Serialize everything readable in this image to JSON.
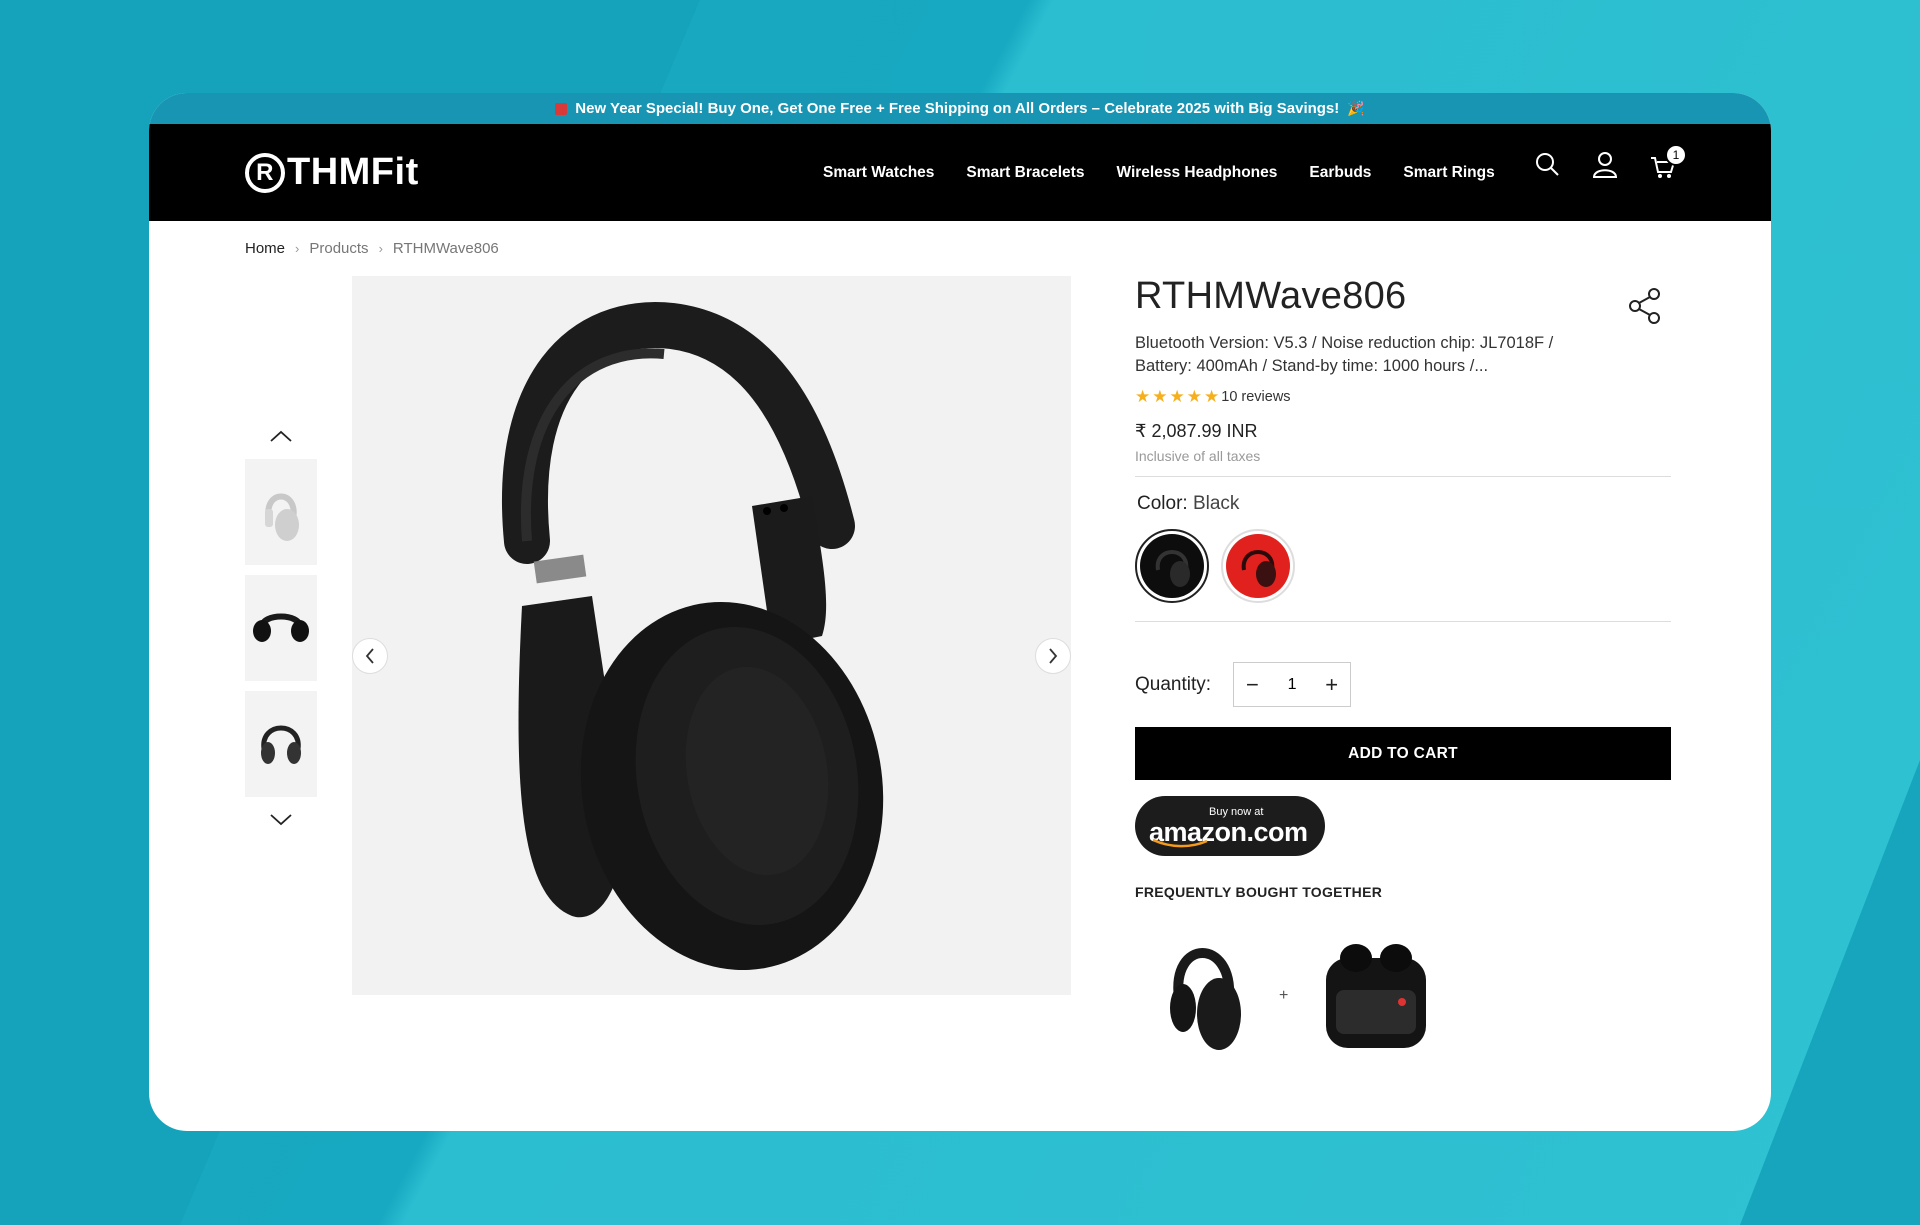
{
  "announcement": {
    "text": "New Year Special! Buy One, Get One Free + Free Shipping on All Orders – Celebrate 2025 with Big Savings!",
    "party_icon": "🎉"
  },
  "header": {
    "logo_text": "THMFit",
    "logo_mark": "R",
    "nav": [
      "Smart Watches",
      "Smart Bracelets",
      "Wireless Headphones",
      "Earbuds",
      "Smart Rings"
    ],
    "cart_count": "1"
  },
  "breadcrumb": {
    "home": "Home",
    "products": "Products",
    "current": "RTHMWave806"
  },
  "product": {
    "title": "RTHMWave806",
    "description": "Bluetooth Version: V5.3 / Noise reduction chip: JL7018F / Battery: 400mAh / Stand-by time: 1000 hours /...",
    "rating": 5,
    "reviews": "10 reviews",
    "price": "₹ 2,087.99 INR",
    "tax_note": "Inclusive of all taxes",
    "color_label": "Color:",
    "color_value": "Black",
    "colors": [
      {
        "name": "Black",
        "hex": "#111111",
        "selected": true
      },
      {
        "name": "Red",
        "hex": "#e0211e",
        "selected": false
      }
    ],
    "quantity_label": "Quantity:",
    "quantity": "1",
    "add_to_cart": "ADD TO CART",
    "amazon_small": "Buy now at",
    "amazon_big": "amazon.com",
    "fbt_title": "FREQUENTLY BOUGHT TOGETHER",
    "fbt_plus": "+"
  },
  "colors": {
    "announce_bg": "#1795b3",
    "header_bg": "#000000",
    "star": "#f6b01e"
  }
}
